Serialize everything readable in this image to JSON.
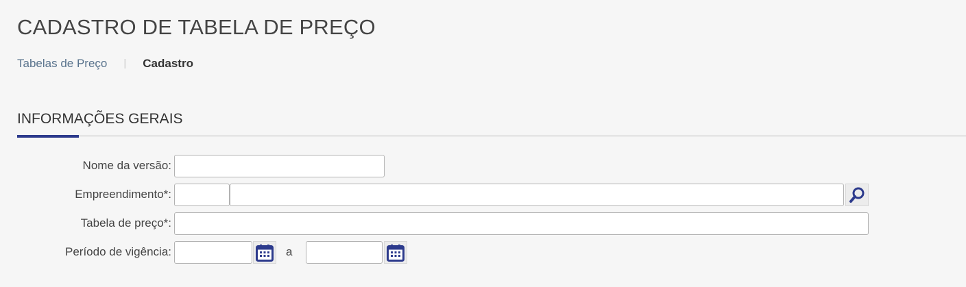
{
  "page": {
    "title": "CADASTRO DE TABELA DE PREÇO"
  },
  "breadcrumb": {
    "items": [
      {
        "label": "Tabelas de Preço"
      },
      {
        "label": "Cadastro"
      }
    ],
    "separator": "|"
  },
  "section": {
    "title": "INFORMAÇÕES GERAIS",
    "accent_color": "#2c3a8c"
  },
  "form": {
    "nome_versao": {
      "label": "Nome da versão:",
      "value": ""
    },
    "empreendimento": {
      "label": "Empreendimento*:",
      "code_value": "",
      "name_value": "",
      "search_icon": "search-icon"
    },
    "tabela_preco": {
      "label": "Tabela de preço*:",
      "value": ""
    },
    "periodo_vigencia": {
      "label": "Período de vigência:",
      "start_value": "",
      "end_value": "",
      "range_separator": "a",
      "calendar_icon": "calendar-icon"
    }
  }
}
